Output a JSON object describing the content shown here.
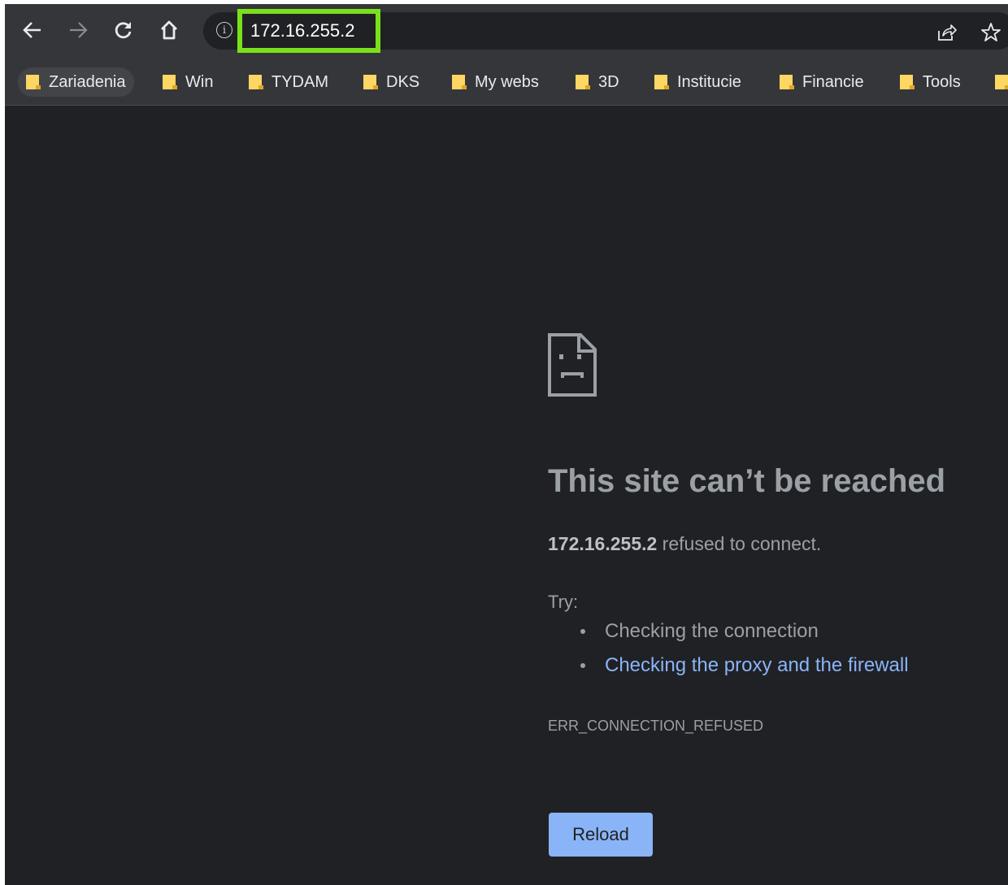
{
  "toolbar": {
    "back_icon": "back-arrow-icon",
    "forward_icon": "forward-arrow-icon",
    "reload_icon": "reload-icon",
    "home_icon": "home-icon",
    "url": "172.16.255.2",
    "highlight_color": "#7be01a"
  },
  "bookmarks": [
    {
      "label": "Zariadenia"
    },
    {
      "label": "Win"
    },
    {
      "label": "TYDAM"
    },
    {
      "label": "DKS"
    },
    {
      "label": "My webs"
    },
    {
      "label": "3D"
    },
    {
      "label": "Institucie"
    },
    {
      "label": "Financie"
    },
    {
      "label": "Tools"
    }
  ],
  "error": {
    "title": "This site can’t be reached",
    "host": "172.16.255.2",
    "summary_suffix": " refused to connect.",
    "try_label": "Try:",
    "suggestions": [
      "Checking the connection",
      "Checking the proxy and the firewall"
    ],
    "code": "ERR_CONNECTION_REFUSED",
    "reload_label": "Reload"
  },
  "colors": {
    "background": "#202124",
    "toolbar": "#35363a",
    "text": "#9aa0a6",
    "link": "#8ab4f8",
    "button": "#8ab4f8",
    "folder": "#fdd663"
  }
}
